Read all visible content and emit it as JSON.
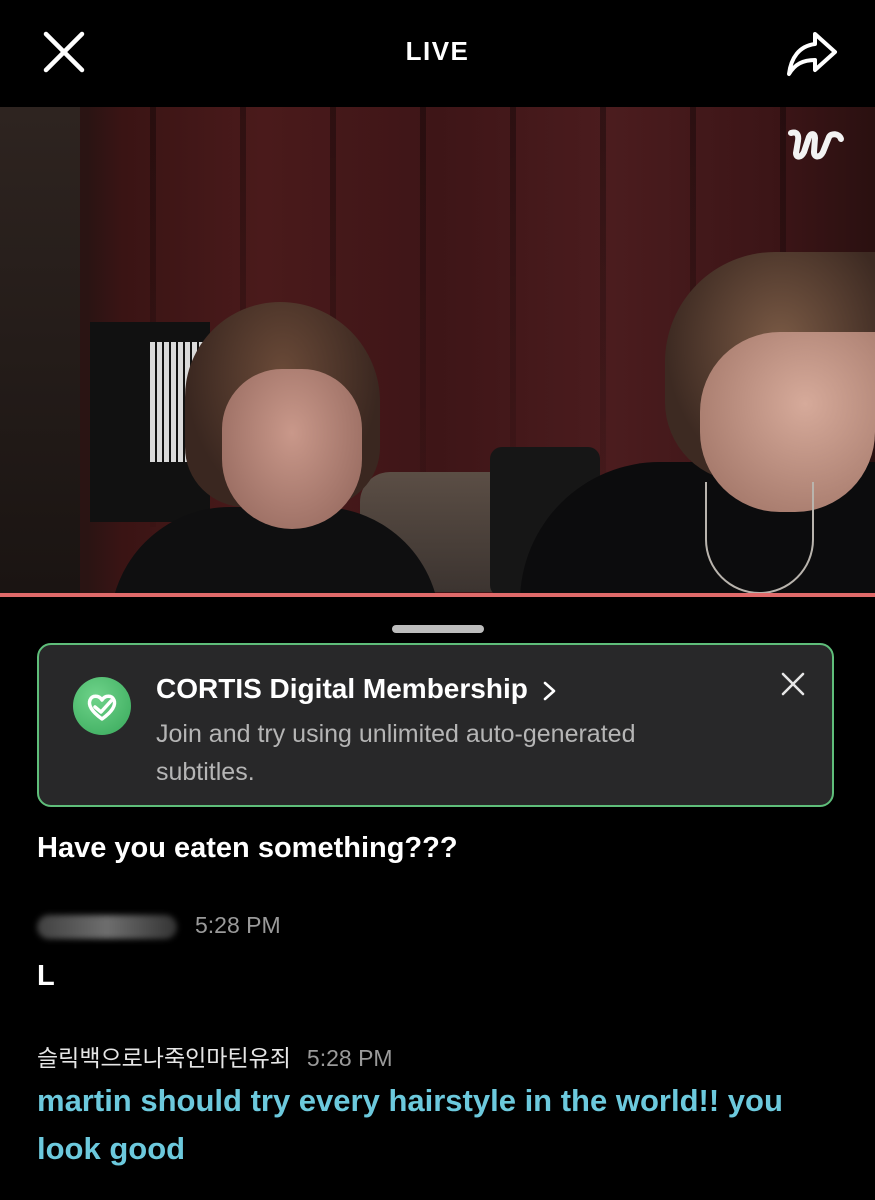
{
  "header": {
    "title": "LIVE",
    "close_icon": "close-icon",
    "share_icon": "share-icon"
  },
  "video": {
    "watermark": "w",
    "progress_color": "#e06a6a"
  },
  "membership_banner": {
    "title": "CORTIS Digital Membership",
    "body": "Join and try using unlimited auto-generated subtitles.",
    "icon": "heart-check-icon",
    "accent": "#5fbe7a"
  },
  "chat": {
    "messages": [
      {
        "text": "Have you eaten something???"
      },
      {
        "username": "",
        "time": "5:28 PM",
        "text": "L"
      },
      {
        "username": "슬릭백으로나죽인마틴유죄",
        "time": "5:28 PM",
        "text": "martin should try every hairstyle in the world!! you look good",
        "color": "#6cc9dd"
      }
    ]
  }
}
